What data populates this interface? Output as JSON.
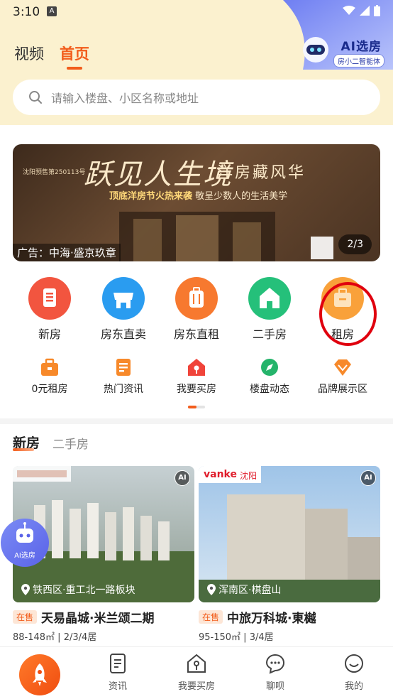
{
  "status_bar": {
    "time": "3:10",
    "badge": "A"
  },
  "ai_corner": {
    "title": "AI选房",
    "subtitle": "房小二智能体"
  },
  "top_tabs": [
    {
      "label": "视频",
      "active": false
    },
    {
      "label": "首页",
      "active": true
    }
  ],
  "search": {
    "placeholder": "请输入楼盘、小区名称或地址"
  },
  "banner": {
    "title": "跃见人生境",
    "subtitle": "洋房藏风华",
    "line2_strong": "顶底洋房节火热来袭",
    "line2_rest": "敬呈少数人的生活美学",
    "presale": "沈阳预售第250113号",
    "ad_text": "广告：中海·盛京玖章",
    "page_indicator": "2/3"
  },
  "categories": [
    {
      "label": "新房",
      "color": "#f2553f",
      "icon": "building-icon"
    },
    {
      "label": "房东直卖",
      "color": "#2a9cf0",
      "icon": "shop-icon"
    },
    {
      "label": "房东直租",
      "color": "#f7792f",
      "icon": "luggage-icon"
    },
    {
      "label": "二手房",
      "color": "#25c07a",
      "icon": "house-icon"
    },
    {
      "label": "租房",
      "color": "#f9a13a",
      "icon": "suitcase-icon"
    }
  ],
  "quick_links": [
    {
      "label": "0元租房",
      "color": "#f7892a",
      "icon": "briefcase-icon"
    },
    {
      "label": "热门资讯",
      "color": "#f7892a",
      "icon": "document-icon"
    },
    {
      "label": "我要买房",
      "color": "#f0443a",
      "icon": "house-key-icon"
    },
    {
      "label": "楼盘动态",
      "color": "#25b46b",
      "icon": "compass-icon"
    },
    {
      "label": "品牌展示区",
      "color": "#f7892a",
      "icon": "diamond-icon"
    }
  ],
  "section_tabs": [
    {
      "label": "新房",
      "active": true
    },
    {
      "label": "二手房",
      "active": false
    }
  ],
  "listings": [
    {
      "location": "铁西区·重工北一路板块",
      "status": "在售",
      "name": "天易晶城·米兰颂二期",
      "info": "88-148㎡ | 2/3/4居",
      "ai": "AI"
    },
    {
      "location": "浑南区·棋盘山",
      "status": "在售",
      "name": "中旅万科城·東樾",
      "info": "95-150㎡ | 3/4居",
      "ai": "AI",
      "brand": "vanke",
      "brand_city": "沈阳"
    }
  ],
  "float_ai": {
    "label": "AI选房"
  },
  "bottom_nav": [
    {
      "label": "",
      "icon": "rocket-icon"
    },
    {
      "label": "资讯",
      "icon": "document-icon"
    },
    {
      "label": "我要买房",
      "icon": "house-key-icon"
    },
    {
      "label": "聊呗",
      "icon": "chat-icon"
    },
    {
      "label": "我的",
      "icon": "smile-icon"
    }
  ],
  "colors": {
    "accent": "#f25d1c",
    "header_bg": "#fbf1cf",
    "highlight_circle": "#e0000e"
  }
}
